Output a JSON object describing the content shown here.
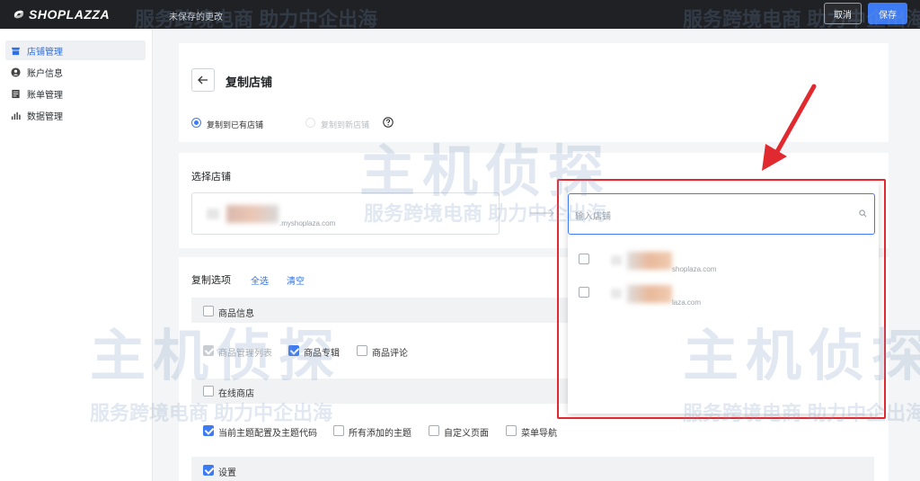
{
  "topbar": {
    "logo": "SHOPLAZZA",
    "unsaved_text": "未保存的更改",
    "cancel_label": "取消",
    "save_label": "保存"
  },
  "sidebar": {
    "items": [
      {
        "label": "店铺管理",
        "icon": "store-icon",
        "active": true
      },
      {
        "label": "账户信息",
        "icon": "user-icon",
        "active": false
      },
      {
        "label": "账单管理",
        "icon": "bill-icon",
        "active": false
      },
      {
        "label": "数据管理",
        "icon": "chart-icon",
        "active": false
      }
    ]
  },
  "page": {
    "title": "复制店铺",
    "radio_existing": "复制到已有店铺",
    "radio_new": "复制到新店铺"
  },
  "select_store": {
    "title": "选择店铺",
    "selected_domain": ".myshoplaza.com"
  },
  "copy_options": {
    "title": "复制选项",
    "select_all": "全选",
    "clear": "清空",
    "groups": [
      {
        "label": "商品信息",
        "checked": false,
        "children": [
          {
            "label": "商品管理列表",
            "checked": true,
            "disabled": true
          },
          {
            "label": "商品专辑",
            "checked": true,
            "disabled": false
          },
          {
            "label": "商品评论",
            "checked": false,
            "disabled": false
          }
        ]
      },
      {
        "label": "在线商店",
        "checked": false,
        "children": [
          {
            "label": "当前主题配置及主题代码",
            "checked": true,
            "disabled": false
          },
          {
            "label": "所有添加的主题",
            "checked": false,
            "disabled": false
          },
          {
            "label": "自定义页面",
            "checked": false,
            "disabled": false
          },
          {
            "label": "菜单导航",
            "checked": false,
            "disabled": false
          }
        ]
      },
      {
        "label": "设置",
        "checked": true,
        "children": []
      }
    ]
  },
  "dropdown": {
    "placeholder": "输入店铺",
    "options": [
      {
        "domain": "shoplaza.com",
        "checked": false
      },
      {
        "domain": "laza.com",
        "checked": false
      }
    ]
  },
  "watermark": {
    "brand": "主机侦探",
    "slogan": "服务跨境电商 助力中企出海"
  },
  "colors": {
    "accent": "#3d7bf5",
    "highlight": "#e02a2f",
    "topbar": "#1f2124"
  }
}
